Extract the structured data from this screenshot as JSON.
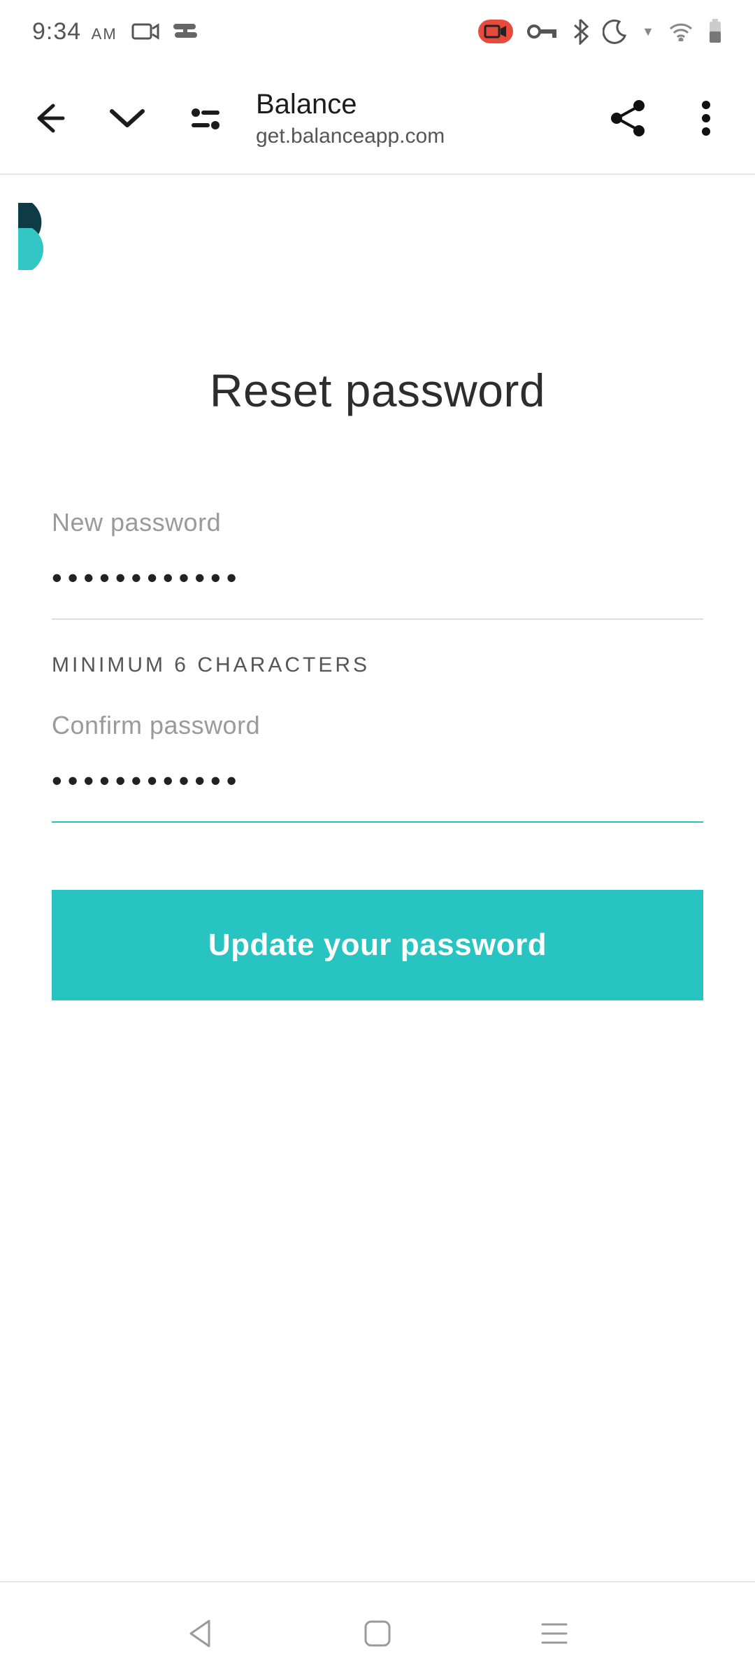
{
  "status": {
    "time": "9:34",
    "ampm": "AM"
  },
  "appbar": {
    "title": "Balance",
    "url": "get.balanceapp.com"
  },
  "content": {
    "heading": "Reset password",
    "new_password_label": "New password",
    "new_password_value": "••••••••••••",
    "hint": "MINIMUM 6 CHARACTERS",
    "confirm_password_label": "Confirm password",
    "confirm_password_value": "••••••••••••",
    "submit_label": "Update your password"
  },
  "colors": {
    "accent": "#27c4c1",
    "brand_dark": "#0f3b47",
    "brand_light": "#34c6c4"
  }
}
